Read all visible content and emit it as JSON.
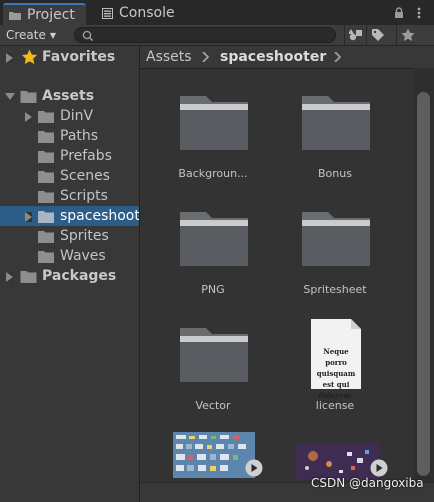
{
  "tabs": [
    {
      "label": "Project",
      "icon": "folder-tab-icon",
      "active": true
    },
    {
      "label": "Console",
      "icon": "console-icon",
      "active": false
    }
  ],
  "toolbar": {
    "create_label": "Create",
    "search_placeholder": ""
  },
  "sidebar": {
    "favorites": "Favorites",
    "assets": "Assets",
    "items": [
      "DinV",
      "Paths",
      "Prefabs",
      "Scenes",
      "Scripts",
      "spaceshooter",
      "Sprites",
      "Waves"
    ],
    "selected": "spaceshooter",
    "packages": "Packages"
  },
  "breadcrumb": [
    "Assets",
    "spaceshooter"
  ],
  "grid": {
    "items": [
      {
        "name": "Backgroun...",
        "kind": "folder"
      },
      {
        "name": "Bonus",
        "kind": "folder"
      },
      {
        "name": "PNG",
        "kind": "folder"
      },
      {
        "name": "Spritesheet",
        "kind": "folder"
      },
      {
        "name": "Vector",
        "kind": "folder"
      },
      {
        "name": "license",
        "kind": "text"
      },
      {
        "name": "",
        "kind": "image"
      },
      {
        "name": "",
        "kind": "image"
      }
    ],
    "license_preview": "Neque porro quisquam est qui dolorem."
  },
  "watermark": "CSDN @dangoxiba",
  "colors": {
    "selection": "#2c5d87",
    "accent": "#3a79bb",
    "star": "#f0b818"
  }
}
